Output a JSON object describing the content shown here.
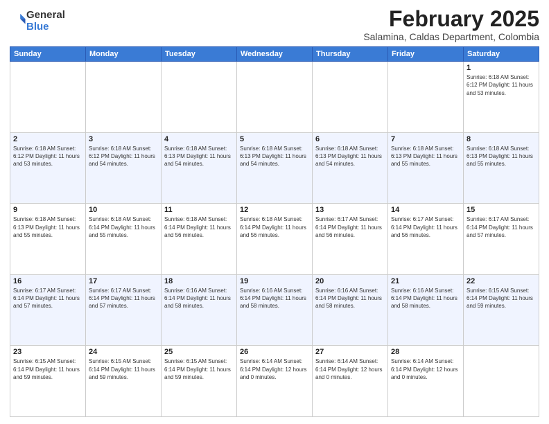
{
  "logo": {
    "general": "General",
    "blue": "Blue"
  },
  "header": {
    "month": "February 2025",
    "location": "Salamina, Caldas Department, Colombia"
  },
  "weekdays": [
    "Sunday",
    "Monday",
    "Tuesday",
    "Wednesday",
    "Thursday",
    "Friday",
    "Saturday"
  ],
  "weeks": [
    [
      {
        "day": "",
        "info": ""
      },
      {
        "day": "",
        "info": ""
      },
      {
        "day": "",
        "info": ""
      },
      {
        "day": "",
        "info": ""
      },
      {
        "day": "",
        "info": ""
      },
      {
        "day": "",
        "info": ""
      },
      {
        "day": "1",
        "info": "Sunrise: 6:18 AM\nSunset: 6:12 PM\nDaylight: 11 hours and 53 minutes."
      }
    ],
    [
      {
        "day": "2",
        "info": "Sunrise: 6:18 AM\nSunset: 6:12 PM\nDaylight: 11 hours and 53 minutes."
      },
      {
        "day": "3",
        "info": "Sunrise: 6:18 AM\nSunset: 6:12 PM\nDaylight: 11 hours and 54 minutes."
      },
      {
        "day": "4",
        "info": "Sunrise: 6:18 AM\nSunset: 6:13 PM\nDaylight: 11 hours and 54 minutes."
      },
      {
        "day": "5",
        "info": "Sunrise: 6:18 AM\nSunset: 6:13 PM\nDaylight: 11 hours and 54 minutes."
      },
      {
        "day": "6",
        "info": "Sunrise: 6:18 AM\nSunset: 6:13 PM\nDaylight: 11 hours and 54 minutes."
      },
      {
        "day": "7",
        "info": "Sunrise: 6:18 AM\nSunset: 6:13 PM\nDaylight: 11 hours and 55 minutes."
      },
      {
        "day": "8",
        "info": "Sunrise: 6:18 AM\nSunset: 6:13 PM\nDaylight: 11 hours and 55 minutes."
      }
    ],
    [
      {
        "day": "9",
        "info": "Sunrise: 6:18 AM\nSunset: 6:13 PM\nDaylight: 11 hours and 55 minutes."
      },
      {
        "day": "10",
        "info": "Sunrise: 6:18 AM\nSunset: 6:14 PM\nDaylight: 11 hours and 55 minutes."
      },
      {
        "day": "11",
        "info": "Sunrise: 6:18 AM\nSunset: 6:14 PM\nDaylight: 11 hours and 56 minutes."
      },
      {
        "day": "12",
        "info": "Sunrise: 6:18 AM\nSunset: 6:14 PM\nDaylight: 11 hours and 56 minutes."
      },
      {
        "day": "13",
        "info": "Sunrise: 6:17 AM\nSunset: 6:14 PM\nDaylight: 11 hours and 56 minutes."
      },
      {
        "day": "14",
        "info": "Sunrise: 6:17 AM\nSunset: 6:14 PM\nDaylight: 11 hours and 56 minutes."
      },
      {
        "day": "15",
        "info": "Sunrise: 6:17 AM\nSunset: 6:14 PM\nDaylight: 11 hours and 57 minutes."
      }
    ],
    [
      {
        "day": "16",
        "info": "Sunrise: 6:17 AM\nSunset: 6:14 PM\nDaylight: 11 hours and 57 minutes."
      },
      {
        "day": "17",
        "info": "Sunrise: 6:17 AM\nSunset: 6:14 PM\nDaylight: 11 hours and 57 minutes."
      },
      {
        "day": "18",
        "info": "Sunrise: 6:16 AM\nSunset: 6:14 PM\nDaylight: 11 hours and 58 minutes."
      },
      {
        "day": "19",
        "info": "Sunrise: 6:16 AM\nSunset: 6:14 PM\nDaylight: 11 hours and 58 minutes."
      },
      {
        "day": "20",
        "info": "Sunrise: 6:16 AM\nSunset: 6:14 PM\nDaylight: 11 hours and 58 minutes."
      },
      {
        "day": "21",
        "info": "Sunrise: 6:16 AM\nSunset: 6:14 PM\nDaylight: 11 hours and 58 minutes."
      },
      {
        "day": "22",
        "info": "Sunrise: 6:15 AM\nSunset: 6:14 PM\nDaylight: 11 hours and 59 minutes."
      }
    ],
    [
      {
        "day": "23",
        "info": "Sunrise: 6:15 AM\nSunset: 6:14 PM\nDaylight: 11 hours and 59 minutes."
      },
      {
        "day": "24",
        "info": "Sunrise: 6:15 AM\nSunset: 6:14 PM\nDaylight: 11 hours and 59 minutes."
      },
      {
        "day": "25",
        "info": "Sunrise: 6:15 AM\nSunset: 6:14 PM\nDaylight: 11 hours and 59 minutes."
      },
      {
        "day": "26",
        "info": "Sunrise: 6:14 AM\nSunset: 6:14 PM\nDaylight: 12 hours and 0 minutes."
      },
      {
        "day": "27",
        "info": "Sunrise: 6:14 AM\nSunset: 6:14 PM\nDaylight: 12 hours and 0 minutes."
      },
      {
        "day": "28",
        "info": "Sunrise: 6:14 AM\nSunset: 6:14 PM\nDaylight: 12 hours and 0 minutes."
      },
      {
        "day": "",
        "info": ""
      }
    ]
  ]
}
